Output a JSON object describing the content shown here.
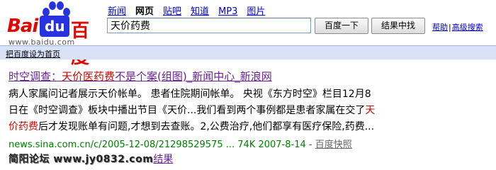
{
  "logo": {
    "brand_latin": "Bai",
    "brand_box": "du",
    "brand_chinese": "百度",
    "domain": "www.baidu.com",
    "colors": {
      "red": "#e10602",
      "blue": "#2932e1"
    }
  },
  "tabs": [
    {
      "label": "新闻",
      "active": false
    },
    {
      "label": "网页",
      "active": true
    },
    {
      "label": "贴吧",
      "active": false
    },
    {
      "label": "知道",
      "active": false
    },
    {
      "label": "MP3",
      "active": false
    },
    {
      "label": "图片",
      "active": false
    }
  ],
  "search": {
    "value": "天价药费",
    "button_search": "百度一下",
    "button_in_results": "结果中找"
  },
  "side_links": {
    "help": "帮助",
    "separator": "|",
    "advanced": "高级搜索"
  },
  "homebar": {
    "link": "把百度设为首页"
  },
  "result": {
    "title_pre": "时空调查：",
    "title_highlight": "天价医药费",
    "title_post": "不是个案(组图)_新闻中心_新浪网",
    "snippet_line1": "病人家属问记者展示天价帐单。 患者住院期间帐单。 央视《东方时空》栏目12月8",
    "snippet_line2_pre": "日在《时空调查》板块中播出节目《天价...我们看到两个事例都是患者家属在交了",
    "snippet_line2_hl": "天",
    "snippet_line3_hl": "价药费",
    "snippet_line3_post": "后才发现账单有问题,才想到去查账。2,公费治疗,他们都享有医疗保险,药费...",
    "url": "news.sina.com.cn/c/2005-12-08/21298529575 ... 74K 2007-8-14 - ",
    "cache_link": "百度快照"
  },
  "watermark_row": {
    "watermark": "简阳论坛 www.jy0832.com",
    "more_text": "结果"
  }
}
